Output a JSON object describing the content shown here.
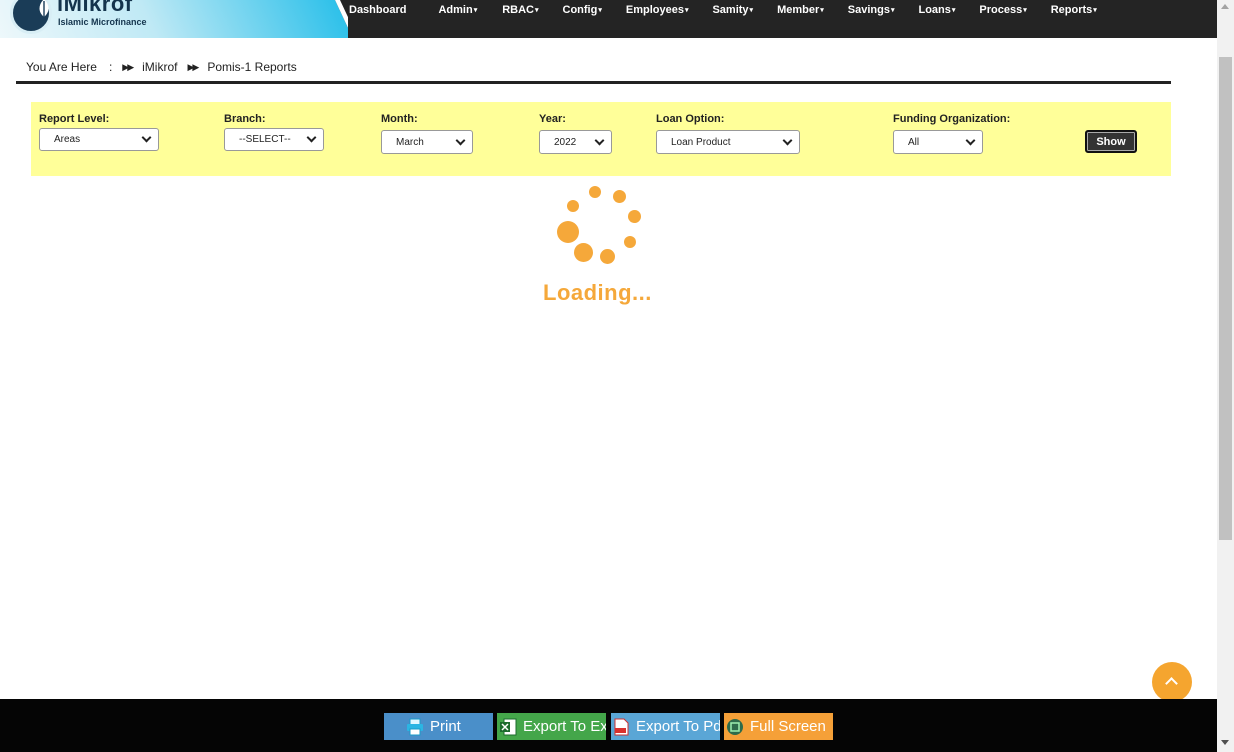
{
  "brand": {
    "title": "iMikrof",
    "subtitle": "Islamic Microfinance"
  },
  "nav": [
    {
      "label": "Dashboard",
      "dropdown": false
    },
    {
      "label": "Admin",
      "dropdown": true
    },
    {
      "label": "RBAC",
      "dropdown": true
    },
    {
      "label": "Config",
      "dropdown": true
    },
    {
      "label": "Employees",
      "dropdown": true
    },
    {
      "label": "Samity",
      "dropdown": true
    },
    {
      "label": "Member",
      "dropdown": true
    },
    {
      "label": "Savings",
      "dropdown": true
    },
    {
      "label": "Loans",
      "dropdown": true
    },
    {
      "label": "Process",
      "dropdown": true
    },
    {
      "label": "Reports",
      "dropdown": true
    }
  ],
  "breadcrumb": {
    "prefix": "You Are Here",
    "colon": ":",
    "items": [
      "iMikrof",
      "Pomis-1 Reports"
    ]
  },
  "filters": {
    "report_level": {
      "label": "Report Level:",
      "value": "Areas"
    },
    "branch": {
      "label": "Branch:",
      "value": "--SELECT--"
    },
    "month": {
      "label": "Month:",
      "value": "March"
    },
    "year": {
      "label": "Year:",
      "value": "2022"
    },
    "loan_option": {
      "label": "Loan Option:",
      "value": "Loan Product"
    },
    "funding_org": {
      "label": "Funding Organization:",
      "value": "All"
    },
    "show_label": "Show"
  },
  "loader": {
    "text": "Loading..."
  },
  "bottom": {
    "print": "Print",
    "excel": "Export To Excel",
    "pdf": "Export To Pdf",
    "full": "Full Screen"
  },
  "colors": {
    "nav_bg": "#242424",
    "filter_bg": "#ffff99",
    "accent": "#f5a83a",
    "print_btn": "#4a8fc9",
    "excel_btn": "#44a64a",
    "pdf_btn": "#5aa6d6",
    "full_btn": "#f5a038"
  },
  "icons": [
    "leaf-logo-icon",
    "chevron-down-icon",
    "double-chevron-right-icon",
    "printer-icon",
    "excel-icon",
    "pdf-icon",
    "fullscreen-icon",
    "arrow-up-icon"
  ]
}
